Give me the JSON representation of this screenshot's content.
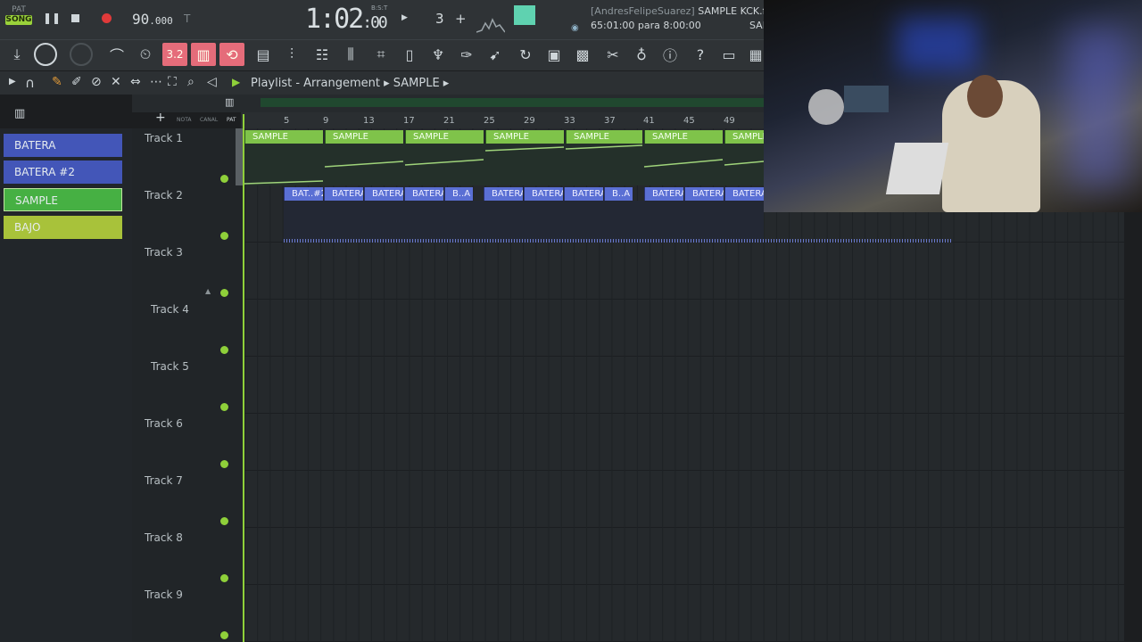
{
  "transport": {
    "pat_label": "PAT",
    "song_label": "SONG",
    "tempo_main": "90",
    "tempo_frac": ".000",
    "time_main": "1:02",
    "time_frac": ":00",
    "time_unit": "B:S:T",
    "pattern_number": "3",
    "project_user": "[AndresFelipeSuarez]",
    "project_file": "SAMPLE KCK.flp",
    "hint": "65:01:00 para 8:00:00",
    "hint_trunc": "SAN"
  },
  "toolbar": {
    "snap_value": "3.2"
  },
  "playlist": {
    "breadcrumb_1": "Playlist - Arrangement",
    "breadcrumb_2": "SAMPLE",
    "ruler": [
      "5",
      "9",
      "13",
      "17",
      "21",
      "25",
      "29",
      "33",
      "37",
      "41",
      "45",
      "49"
    ],
    "mini_labels": [
      "NOTA",
      "CANAL",
      "PAT"
    ]
  },
  "patterns": [
    {
      "label": "BATERA",
      "color": "#4356b8"
    },
    {
      "label": "BATERA #2",
      "color": "#4356b8"
    },
    {
      "label": "SAMPLE",
      "color": "#46b043"
    },
    {
      "label": "BAJO",
      "color": "#a8c23a"
    }
  ],
  "tracks": [
    "Track 1",
    "Track 2",
    "Track 3",
    "Track 4",
    "Track 5",
    "Track 6",
    "Track 7",
    "Track 8",
    "Track 9"
  ],
  "clips_track1": [
    "SAMPLE",
    "SAMPLE",
    "SAMPLE",
    "SAMPLE",
    "SAMPLE",
    "SAMPLE",
    "SAMPLE"
  ],
  "clips_track2": [
    "BAT..#2",
    "BATERA",
    "BATERA",
    "BATERA",
    "B..A",
    "BATERA",
    "BATERA",
    "BATERA",
    "B..A",
    "BATERA",
    "BATERA",
    "BATERA"
  ],
  "colors": {
    "accent_green": "#8fd03a",
    "sample_clip": "#7fc34a",
    "drum_clip": "#5a6fd4",
    "pink_toggle": "#e56c7a"
  }
}
